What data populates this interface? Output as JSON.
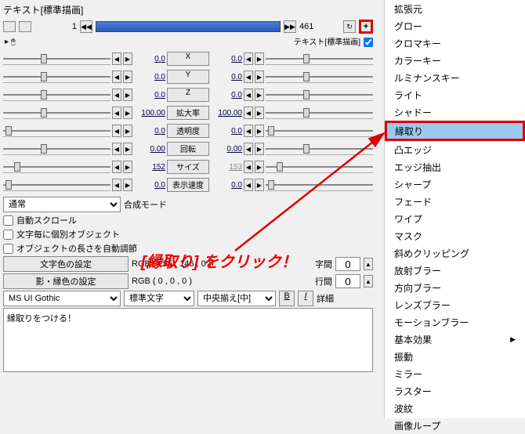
{
  "title": "テキスト[標準描画]",
  "timeline": {
    "frame_start": "1",
    "frame_end": "461"
  },
  "sub_title": "テキスト[標準描画]",
  "params": [
    {
      "label": "X",
      "left": "0.0",
      "right": "0.0",
      "thumb_l": 35,
      "thumb_r": 35
    },
    {
      "label": "Y",
      "left": "0.0",
      "right": "0.0",
      "thumb_l": 35,
      "thumb_r": 35
    },
    {
      "label": "Z",
      "left": "0.0",
      "right": "0.0",
      "thumb_l": 35,
      "thumb_r": 35
    },
    {
      "label": "拡大率",
      "left": "100.00",
      "right": "100.00",
      "thumb_l": 35,
      "thumb_r": 35
    },
    {
      "label": "透明度",
      "left": "0.0",
      "right": "0.0",
      "thumb_l": 2,
      "thumb_r": 2
    },
    {
      "label": "回転",
      "left": "0.00",
      "right": "0.00",
      "thumb_l": 35,
      "thumb_r": 35
    },
    {
      "label": "サイズ",
      "left": "152",
      "right": "153",
      "right_gray": true,
      "thumb_l": 10,
      "thumb_r": 10
    },
    {
      "label": "表示速度",
      "left": "0.0",
      "right": "0.0",
      "thumb_l": 2,
      "thumb_r": 2
    }
  ],
  "blend_mode": {
    "value": "通常",
    "label": "合成モード"
  },
  "checkboxes": {
    "auto_scroll": "自動スクロール",
    "individual": "文字毎に個別オブジェクト",
    "auto_adjust": "オブジェクトの長さを自動調節"
  },
  "color_buttons": {
    "text": "文字色の設定",
    "shadow": "影・縁色の設定"
  },
  "rgb": {
    "text": "RGB ( 255 , 146 , 0 )",
    "shadow": "RGB ( 0 , 0 , 0 )"
  },
  "spacing": {
    "char_label": "字間",
    "char_value": "0",
    "line_label": "行間",
    "line_value": "0"
  },
  "font": {
    "name": "MS UI Gothic",
    "style": "標準文字",
    "align": "中央揃え[中]",
    "b": "B",
    "i": "I",
    "detail": "詳細"
  },
  "textarea_value": "縁取りをつける！",
  "menu": {
    "items": [
      "拡張元",
      "グロー",
      "クロマキー",
      "カラーキー",
      "ルミナンスキー",
      "ライト",
      "シャドー",
      "縁取り",
      "凸エッジ",
      "エッジ抽出",
      "シャープ",
      "フェード",
      "ワイプ",
      "マスク",
      "斜めクリッピング",
      "放射ブラー",
      "方向ブラー",
      "レンズブラー",
      "モーションブラー",
      "基本効果",
      "振動",
      "ミラー",
      "ラスター",
      "波紋",
      "画像ループ"
    ],
    "highlighted_index": 7,
    "submenu_index": 19
  },
  "annotation": "[縁取り] をクリック！"
}
